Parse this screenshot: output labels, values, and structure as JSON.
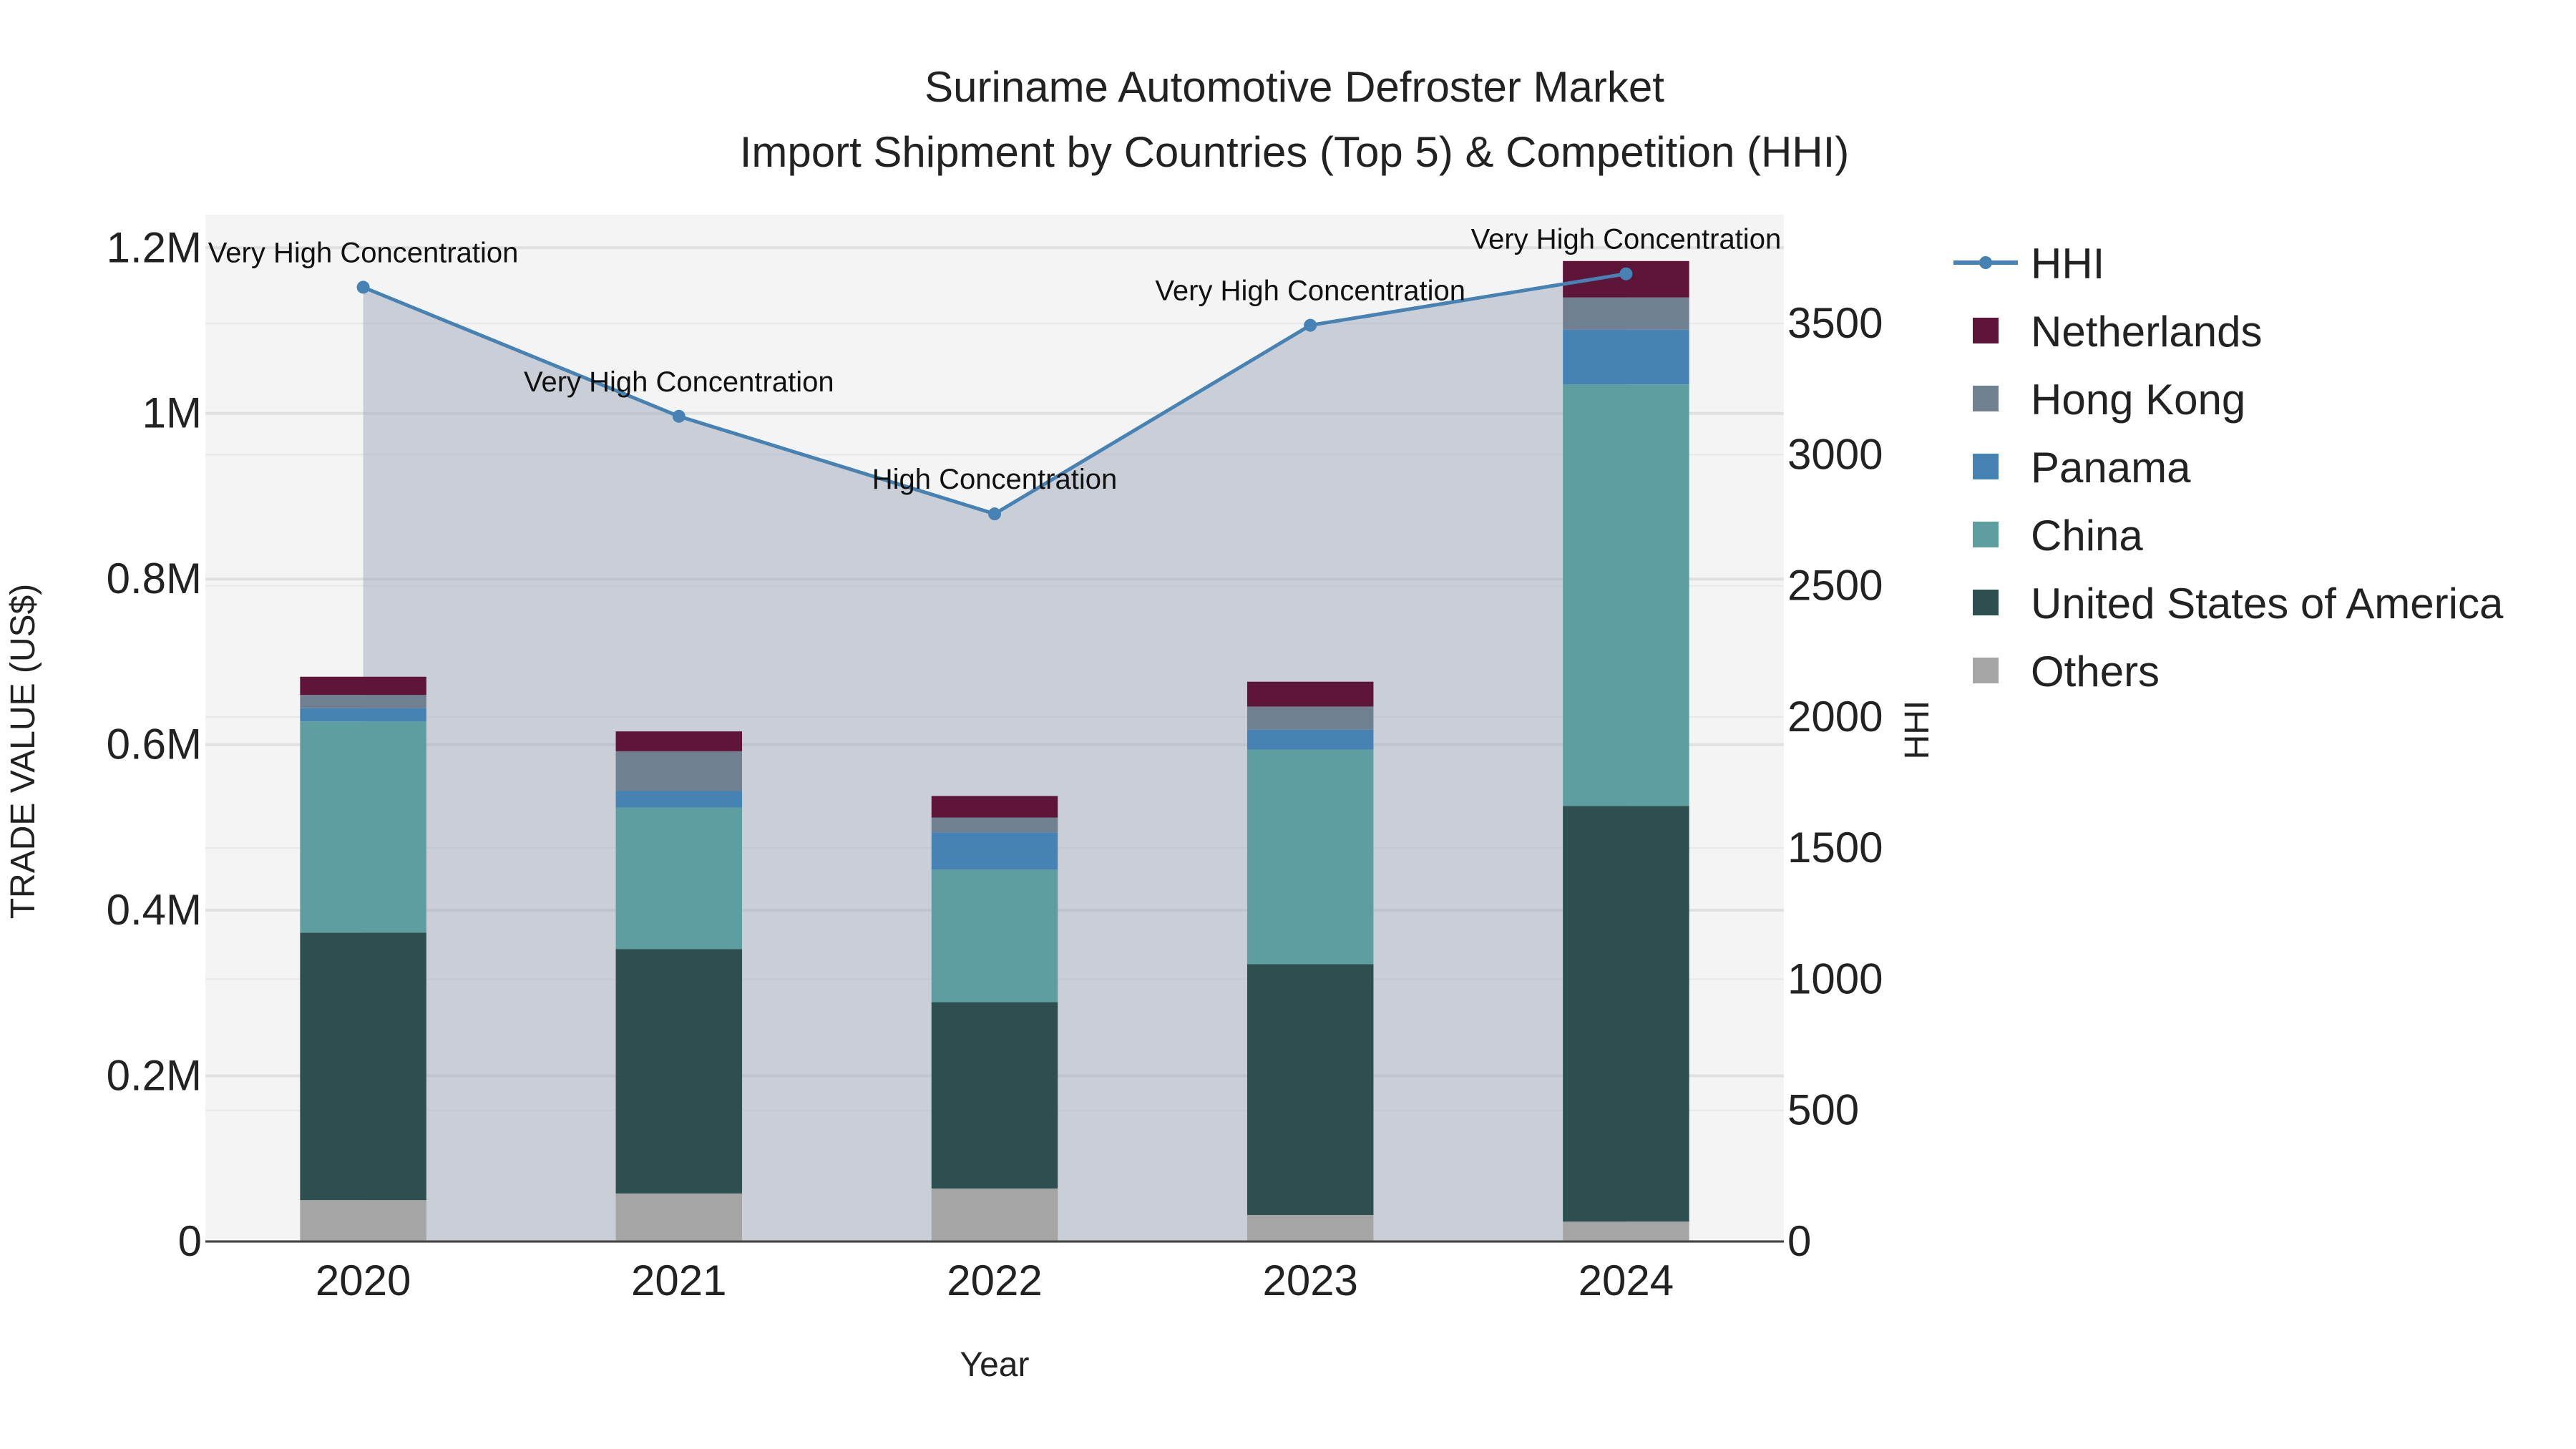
{
  "chart_data": {
    "type": "bar",
    "title": "Suriname Automotive Defroster Market",
    "subtitle": "Import Shipment by Countries (Top 5) & Competition (HHI)",
    "xlabel": "Year",
    "ylabel": "TRADE VALUE (US$)",
    "y2label": "HHI",
    "categories": [
      "2020",
      "2021",
      "2022",
      "2023",
      "2024"
    ],
    "ylim": [
      0,
      1240000
    ],
    "y2lim": [
      0,
      3900
    ],
    "yticks": [
      {
        "v": 0,
        "t": "0"
      },
      {
        "v": 200000,
        "t": "0.2M"
      },
      {
        "v": 400000,
        "t": "0.4M"
      },
      {
        "v": 600000,
        "t": "0.6M"
      },
      {
        "v": 800000,
        "t": "0.8M"
      },
      {
        "v": 1000000,
        "t": "1M"
      },
      {
        "v": 1200000,
        "t": "1.2M"
      }
    ],
    "y2ticks": [
      0,
      500,
      1000,
      1500,
      2000,
      2500,
      3000,
      3500
    ],
    "series": [
      {
        "name": "Others",
        "color": "#a5a5a5",
        "values": [
          50000,
          58000,
          64000,
          32000,
          24000
        ]
      },
      {
        "name": "United States of America",
        "color": "#2e4f4f",
        "values": [
          323000,
          295000,
          225000,
          303000,
          502000
        ]
      },
      {
        "name": "China",
        "color": "#5f9ea0",
        "values": [
          255000,
          171000,
          160000,
          259000,
          509000
        ]
      },
      {
        "name": "Panama",
        "color": "#4682b4",
        "values": [
          16000,
          20000,
          45000,
          24000,
          66000
        ]
      },
      {
        "name": "Hong Kong",
        "color": "#708090",
        "values": [
          16000,
          48000,
          18000,
          28000,
          39000
        ]
      },
      {
        "name": "Netherlands",
        "color": "#5e1537",
        "values": [
          22000,
          24000,
          26000,
          30000,
          44000
        ]
      }
    ],
    "hhi": {
      "name": "HHI",
      "color": "#4682b4",
      "values": [
        3638,
        3146,
        2774,
        3493,
        3689
      ],
      "labels": [
        "Very High Concentration",
        "Very High Concentration",
        "High Concentration",
        "Very High Concentration",
        "Very High Concentration"
      ]
    },
    "legend_order": [
      "HHI",
      "Netherlands",
      "Hong Kong",
      "Panama",
      "China",
      "United States of America",
      "Others"
    ],
    "legend_position": "right",
    "grid": true
  }
}
